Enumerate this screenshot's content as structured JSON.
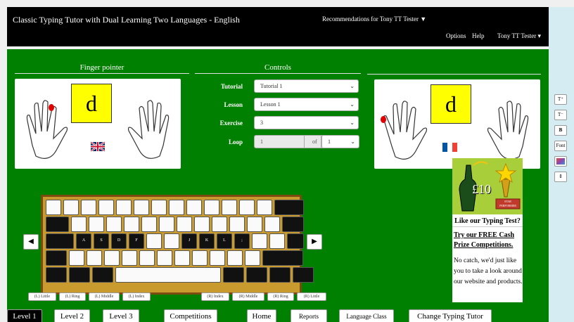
{
  "header": {
    "title": "Classic Typing Tutor with Dual Learning Two Languages - English",
    "recommendations": "Recommendations for Tony TT Tester ▼",
    "menu": [
      "Options",
      "Help",
      "Tony TT Tester ▾"
    ]
  },
  "finger_pointer": {
    "heading": "Finger pointer",
    "letter": "d"
  },
  "controls": {
    "heading": "Controls",
    "tutorial_label": "Tutorial",
    "tutorial_value": "Tutorial 1",
    "lesson_label": "Lesson",
    "lesson_value": "Lesson 1",
    "exercise_label": "Exercise",
    "exercise_value": "3",
    "loop_label": "Loop",
    "loop_value": "1",
    "loop_of": "of",
    "loop_total": "1"
  },
  "second_pointer": {
    "letter": "d"
  },
  "keyboard": {
    "home_labels": [
      "A",
      "S",
      "D",
      "F",
      "J",
      "K",
      "L",
      ";"
    ]
  },
  "finger_buttons": [
    "(L) Little",
    "(L) Ring",
    "(L) Middle",
    "(L) Index",
    "(R) Index",
    "(R) Middle",
    "(R) Ring",
    "(R) Little"
  ],
  "ad": {
    "amount": "£10",
    "badge": "STAR PERFORMER",
    "heading": "Like our Typing Test?",
    "link": "Try our FREE Cash Prize Competitions.",
    "body": "No catch, we'd just like you to take a look around our website and products."
  },
  "bottom_tabs": [
    "Level 1",
    "Level 2",
    "Level 3",
    "Competitions",
    "Home",
    "Reports",
    "Language Class",
    "Change Typing Tutor"
  ],
  "side_tools": [
    "T⁺",
    "T⁻",
    "B",
    "Font",
    "",
    "⇕"
  ],
  "colors": {
    "accent_green": "#008000",
    "letter_yellow": "#ffff00",
    "finger_red": "#e00000"
  }
}
